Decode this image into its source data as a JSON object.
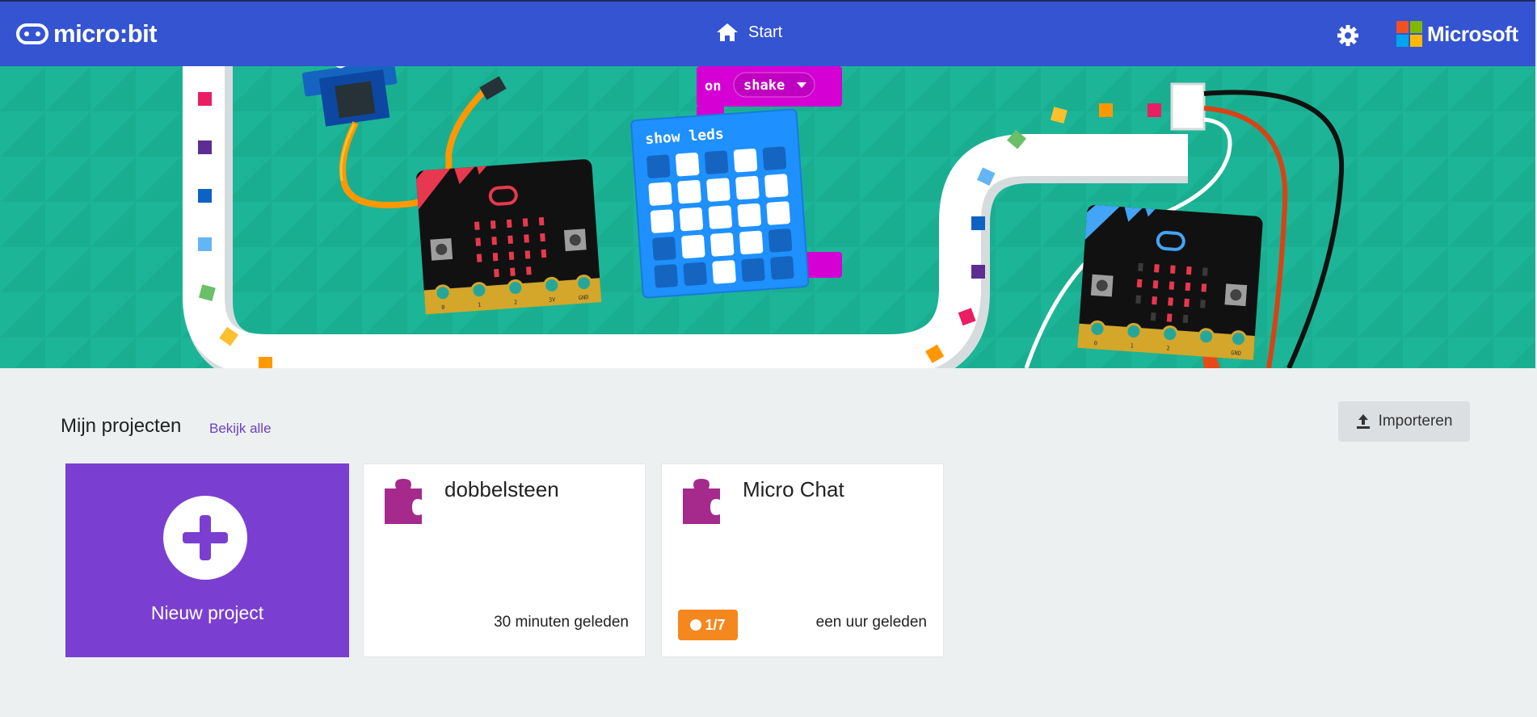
{
  "header": {
    "brand": "micro:bit",
    "home_label": "Start",
    "microsoft_label": "Microsoft"
  },
  "banner": {
    "event_block_on": "on",
    "event_block_value": "shake",
    "leds_block_label": "show leds",
    "leds_pattern": [
      [
        0,
        1,
        0,
        1,
        0
      ],
      [
        1,
        1,
        1,
        1,
        1
      ],
      [
        1,
        1,
        1,
        1,
        1
      ],
      [
        0,
        1,
        1,
        1,
        0
      ],
      [
        0,
        0,
        1,
        0,
        0
      ]
    ],
    "pin_labels": [
      "0",
      "1",
      "2",
      "3V",
      "GND"
    ]
  },
  "projects": {
    "title": "Mijn projecten",
    "see_all": "Bekijk alle",
    "import_label": "Importeren",
    "new_project_label": "Nieuw project",
    "items": [
      {
        "name": "dobbelsteen",
        "time": "30 minuten geleden"
      },
      {
        "name": "Micro Chat",
        "time": "een uur geleden",
        "badge": "1/7"
      }
    ]
  },
  "colors": {
    "header": "#3454d1",
    "banner": "#1db597",
    "new_project": "#7a3fd0",
    "puzzle": "#a52a8c",
    "badge": "#f5871f"
  }
}
